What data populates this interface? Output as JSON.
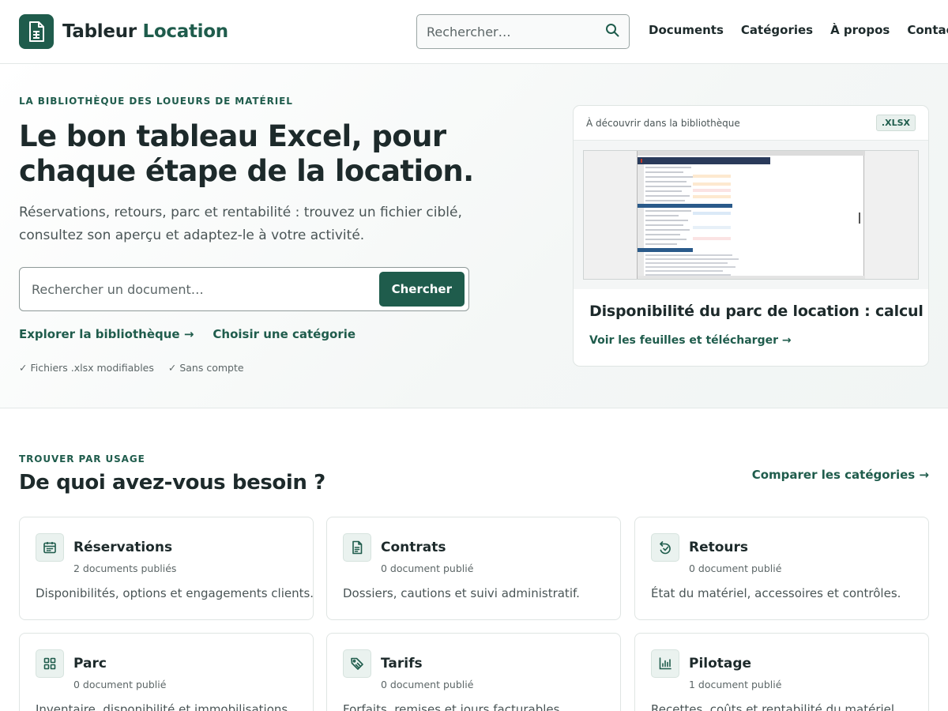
{
  "header": {
    "brand_part1": "Tableur",
    "brand_part2": "Location",
    "search_placeholder": "Rechercher…",
    "nav": [
      "Documents",
      "Catégories",
      "À propos",
      "Contact"
    ]
  },
  "hero": {
    "eyebrow": "La bibliothèque des loueurs de matériel",
    "title": "Le bon tableau Excel, pour chaque étape de la location.",
    "subtitle": "Réservations, retours, parc et rentabilité : trouvez un fichier ciblé, consultez son aperçu et adaptez-le à votre activité.",
    "search_placeholder": "Rechercher un document…",
    "search_button": "Chercher",
    "links": [
      "Explorer la bibliothèque →",
      "Choisir une catégorie"
    ],
    "checks": [
      "✓ Fichiers .xlsx modifiables",
      "✓ Sans compte"
    ]
  },
  "featured": {
    "label": "À découvrir dans la bibliothèque",
    "badge": ".XLSX",
    "title": "Disponibilité du parc de location : calcul Excel",
    "link": "Voir les feuilles et télécharger →"
  },
  "categories_section": {
    "eyebrow": "Trouver par usage",
    "title": "De quoi avez-vous besoin ?",
    "compare_link": "Comparer les catégories →",
    "cards": [
      {
        "title": "Réservations",
        "count": "2 documents publiés",
        "desc": "Disponibilités, options et engagements clients.",
        "icon": "calendar-icon"
      },
      {
        "title": "Contrats",
        "count": "0 document publié",
        "desc": "Dossiers, cautions et suivi administratif.",
        "icon": "document-icon"
      },
      {
        "title": "Retours",
        "count": "0 document publié",
        "desc": "État du matériel, accessoires et contrôles.",
        "icon": "return-check-icon"
      },
      {
        "title": "Parc",
        "count": "0 document publié",
        "desc": "Inventaire, disponibilité et immobilisations.",
        "icon": "grid-icon"
      },
      {
        "title": "Tarifs",
        "count": "0 document publié",
        "desc": "Forfaits, remises et jours facturables.",
        "icon": "tag-icon"
      },
      {
        "title": "Pilotage",
        "count": "1 document publié",
        "desc": "Recettes, coûts et rentabilité du matériel.",
        "icon": "bar-chart-icon"
      }
    ]
  },
  "colors": {
    "accent": "#1f5c4c",
    "text": "#1d2a2b",
    "muted": "#5c6667"
  }
}
